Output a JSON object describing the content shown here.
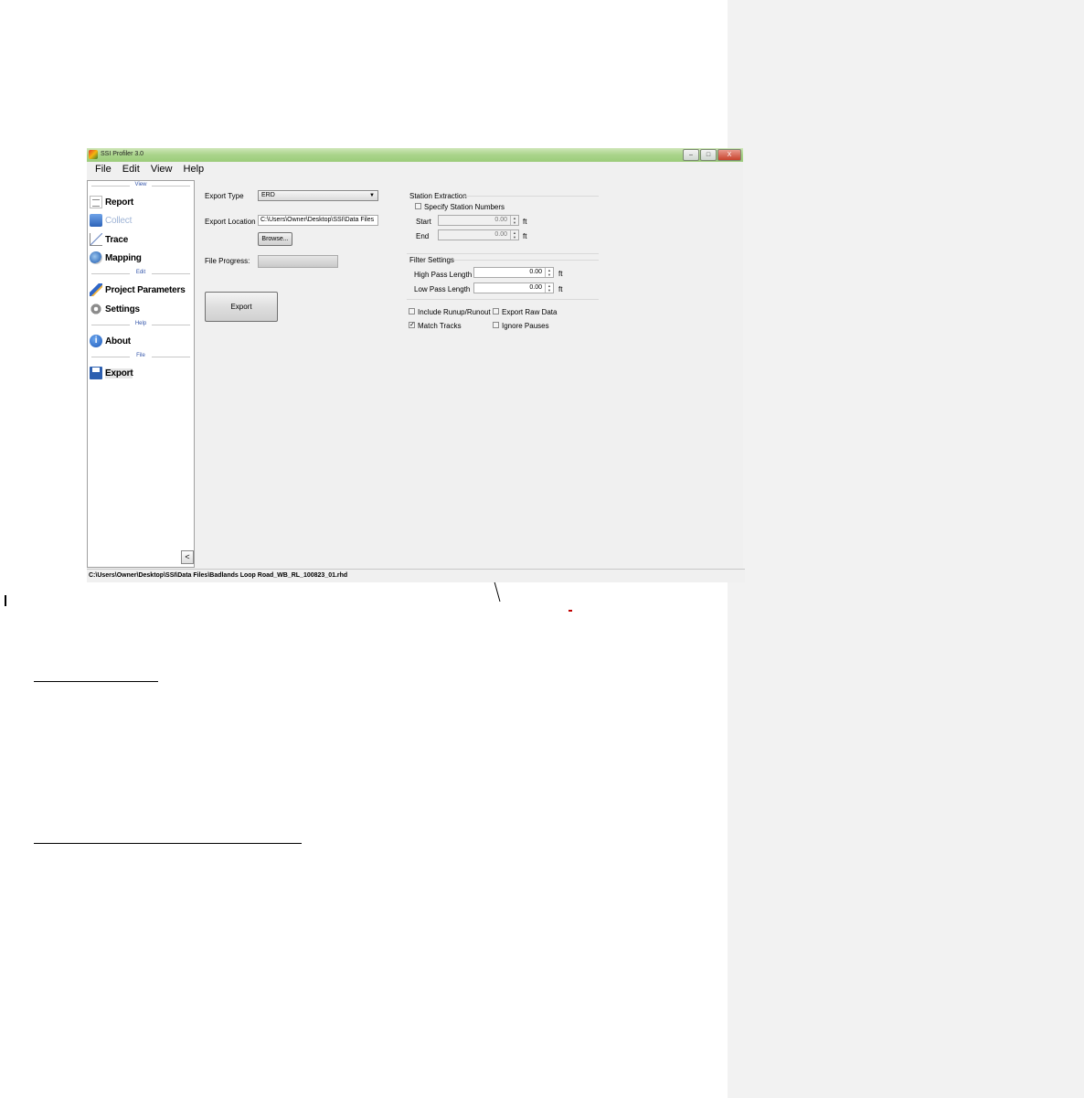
{
  "window": {
    "title": "SSI Profiler 3.0",
    "controls": {
      "minimize": "–",
      "maximize": "□",
      "close": "X"
    }
  },
  "menu": [
    "File",
    "Edit",
    "View",
    "Help"
  ],
  "sidebar": {
    "sections": {
      "view": "View",
      "edit": "Edit",
      "help": "Help",
      "file": "File"
    },
    "items": {
      "report": "Report",
      "collect": "Collect",
      "trace": "Trace",
      "mapping": "Mapping",
      "project_parameters": "Project Parameters",
      "settings": "Settings",
      "about": "About",
      "export": "Export"
    },
    "collapse_label": "<"
  },
  "export_form": {
    "export_type_label": "Export Type",
    "export_type_value": "ERD",
    "export_location_label": "Export Location",
    "export_location_value": "C:\\Users\\Owner\\Desktop\\SSI\\Data Files",
    "browse_label": "Browse...",
    "file_progress_label": "File Progress:",
    "file_progress_fraction": 0,
    "export_button": "Export"
  },
  "station_extraction": {
    "title": "Station Extraction",
    "specify_label": "Specify Station Numbers",
    "specify_checked": false,
    "start_label": "Start",
    "start_value": "0.00",
    "end_label": "End",
    "end_value": "0.00",
    "unit": "ft"
  },
  "filter_settings": {
    "title": "Filter Settings",
    "high_pass_label": "High Pass Length",
    "high_pass_value": "0.00",
    "low_pass_label": "Low Pass Length",
    "low_pass_value": "0.00",
    "unit": "ft"
  },
  "options": {
    "include_runup_label": "Include Runup/Runout",
    "include_runup_checked": false,
    "export_raw_label": "Export Raw Data",
    "export_raw_checked": false,
    "match_tracks_label": "Match Tracks",
    "match_tracks_checked": true,
    "ignore_pauses_label": "Ignore Pauses",
    "ignore_pauses_checked": false
  },
  "status_bar": {
    "path": "C:\\Users\\Owner\\Desktop\\SSI\\Data Files\\Badlands Loop Road_WB_RL_100823_01.rhd"
  },
  "colors": {
    "titlebar": "#a9d48a",
    "comment_pane": "#f2f2f2",
    "red_mark": "#c00000"
  }
}
